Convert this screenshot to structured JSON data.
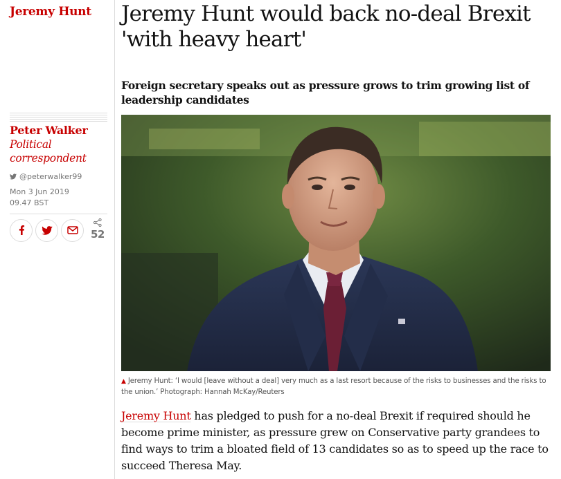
{
  "section_tag": "Jeremy Hunt",
  "headline": "Jeremy Hunt would back no-deal Brexit 'with heavy heart'",
  "standfirst": "Foreign secretary speaks out as pressure grows to trim growing list of leadership candidates",
  "byline": {
    "author": "Peter Walker",
    "role": "Political correspondent",
    "twitter_handle": "@peterwalker99",
    "date": "Mon 3 Jun 2019",
    "time": "09.47 BST"
  },
  "share": {
    "facebook_icon": "facebook-icon",
    "twitter_icon": "twitter-icon",
    "email_icon": "email-icon",
    "count": "52"
  },
  "image": {
    "description_icon": "photo"
  },
  "caption": {
    "marker": "▲",
    "text": "Jeremy Hunt: ‘I would [leave without a deal] very much as a last resort because of the risks to businesses and the risks to the union.’ Photograph: Hannah McKay/Reuters"
  },
  "body": {
    "link_text": "Jeremy Hunt",
    "text": " has pledged to push for a no-deal Brexit if required should he become prime minister, as pressure grew on Conservative party grandees to find ways to trim a bloated field of 13 candidates so as to speed up the race to succeed Theresa May."
  },
  "colors": {
    "accent": "#c70000",
    "text": "#121212",
    "muted": "#767676"
  }
}
